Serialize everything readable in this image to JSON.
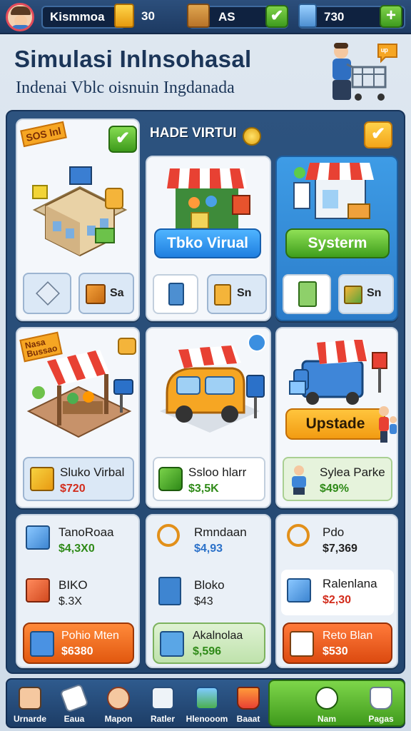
{
  "header": {
    "player_name": "Kismmoa",
    "coins": "30",
    "boxes": "AS",
    "cash": "730",
    "plus_label": "+",
    "check_label": "✔"
  },
  "page": {
    "title": "Simulasi Inlnsohasal",
    "subtitle": "Indenai Vblc oisnuin Ingdanada",
    "badge_text": "ᵘᵖ"
  },
  "columns": {
    "col1": {
      "tag": "SOS",
      "tag2": "lnl",
      "mini_right": "Sa",
      "tag_row2_line1": "Nasa",
      "tag_row2_line2": "Bussao",
      "row3_title": "Sluko Virbal",
      "row3_price": "$720",
      "items": [
        {
          "title": "TanoRoaa",
          "price": "$4,3X0",
          "price_color": "green"
        },
        {
          "title": "BIKO",
          "price": "$.3X",
          "price_color": "dark"
        }
      ],
      "cta_title": "Pohio Mten",
      "cta_price": "$6380"
    },
    "col2": {
      "header": "HADE VIRTUI",
      "button": "Tbko Virual",
      "mini_right": "Sn",
      "row3_title": "Ssloo hlarr",
      "row3_price": "$3,5K",
      "items": [
        {
          "title": "Rmndaan",
          "price": "$4,93",
          "price_color": "blue"
        },
        {
          "title": "Bloko",
          "price": "$43",
          "price_color": "dark"
        }
      ],
      "cta_title": "Akalnolaa",
      "cta_price": "$,596"
    },
    "col3": {
      "button": "Systerm",
      "mini_right": "Sn",
      "cta_upgrade": "Upstade",
      "row3_title": "Sylea Parke",
      "row3_price": "$49%",
      "items": [
        {
          "title": "Pdo",
          "price": "$7,369",
          "price_color": "dark"
        },
        {
          "title": "Ralenlana",
          "price": "$2,30",
          "price_color": "red"
        }
      ],
      "cta_title": "Reto Blan",
      "cta_price": "$530"
    }
  },
  "bottom_nav": [
    {
      "label": "Urnarde",
      "icon": "person-icon"
    },
    {
      "label": "Eaua",
      "icon": "paper-icon"
    },
    {
      "label": "Mapon",
      "icon": "character-icon"
    },
    {
      "label": "Ratler",
      "icon": "papers-icon"
    },
    {
      "label": "Hlenooom",
      "icon": "picture-icon"
    },
    {
      "label": "Baaat",
      "icon": "basket-icon"
    },
    {
      "label": "Nam",
      "icon": "speaker-icon"
    },
    {
      "label": "Pagas",
      "icon": "pot-icon"
    }
  ],
  "colors": {
    "accent_green": "#3f9e1c",
    "accent_blue": "#1f7fe0",
    "accent_orange": "#f29b12",
    "panel_navy": "#23466f"
  }
}
